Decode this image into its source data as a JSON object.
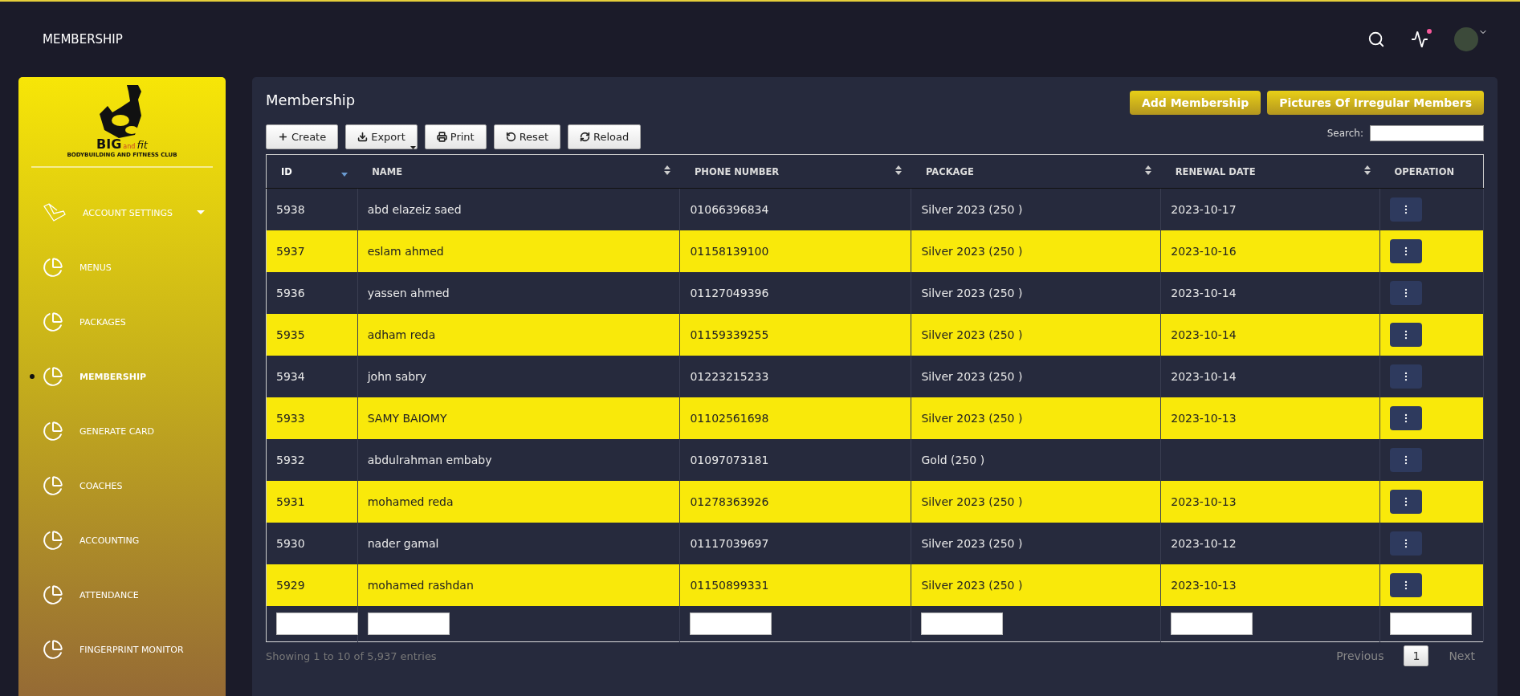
{
  "header": {
    "title": "MEMBERSHIP",
    "notification": true
  },
  "logo": {
    "word": "BIG",
    "accent": "and",
    "word2": "fit",
    "tagline": "BODYBUILDING AND FITNESS CLUB"
  },
  "sidebar": {
    "items": [
      {
        "label": "ACCOUNT SETTINGS",
        "kind": "dropdown",
        "selected": false
      },
      {
        "label": "MENUS",
        "kind": "link",
        "selected": false
      },
      {
        "label": "PACKAGES",
        "kind": "link",
        "selected": false
      },
      {
        "label": "MEMBERSHIP",
        "kind": "link",
        "selected": true
      },
      {
        "label": "GENERATE CARD",
        "kind": "link",
        "selected": false
      },
      {
        "label": "COACHES",
        "kind": "link",
        "selected": false
      },
      {
        "label": "ACCOUNTING",
        "kind": "link",
        "selected": false
      },
      {
        "label": "ATTENDANCE",
        "kind": "link",
        "selected": false
      },
      {
        "label": "FINGERPRINT MONITOR",
        "kind": "link",
        "selected": false
      }
    ]
  },
  "panel": {
    "title": "Membership",
    "actions": [
      "Add Membership",
      "Pictures Of Irregular Members"
    ],
    "toolbar": [
      {
        "label": "Create",
        "kind": "plus"
      },
      {
        "label": "Export",
        "kind": "download"
      },
      {
        "label": "Print",
        "kind": "print"
      },
      {
        "label": "Reset",
        "kind": "undo"
      },
      {
        "label": "Reload",
        "kind": "refresh"
      }
    ],
    "search": {
      "label": "Search:"
    }
  },
  "table": {
    "columns": [
      {
        "label": "ID",
        "sortable": true,
        "sorted": true
      },
      {
        "label": "NAME",
        "sortable": true,
        "sorted": false
      },
      {
        "label": "PHONE NUMBER",
        "sortable": true,
        "sorted": false
      },
      {
        "label": "PACKAGE",
        "sortable": true,
        "sorted": false
      },
      {
        "label": "RENEWAL DATE",
        "sortable": true,
        "sorted": false
      },
      {
        "label": "OPERATION",
        "sortable": false,
        "sorted": false
      }
    ],
    "rows": [
      [
        "5938",
        "abd elazeiz saed",
        "01066396834",
        "Silver 2023 (250 )",
        "2023-10-17"
      ],
      [
        "5937",
        "eslam ahmed",
        "01158139100",
        "Silver 2023 (250 )",
        "2023-10-16"
      ],
      [
        "5936",
        "yassen ahmed",
        "01127049396",
        "Silver 2023 (250 )",
        "2023-10-14"
      ],
      [
        "5935",
        "adham reda",
        "01159339255",
        "Silver 2023 (250 )",
        "2023-10-14"
      ],
      [
        "5934",
        "john sabry",
        "01223215233",
        "Silver 2023 (250 )",
        "2023-10-14"
      ],
      [
        "5933",
        "SAMY BAIOMY",
        "01102561698",
        "Silver 2023 (250 )",
        "2023-10-13"
      ],
      [
        "5932",
        "abdulrahman embaby",
        "01097073181",
        "Gold (250 )",
        ""
      ],
      [
        "5931",
        "mohamed reda",
        "01278363926",
        "Silver 2023 (250 )",
        "2023-10-13"
      ],
      [
        "5930",
        "nader gamal",
        "01117039697",
        "Silver 2023 (250 )",
        "2023-10-12"
      ],
      [
        "5929",
        "mohamed rashdan",
        "01150899331",
        "Silver 2023 (250 )",
        "2023-10-13"
      ]
    ]
  },
  "footer": {
    "info": "Showing 1 to 10 of 5,937 entries",
    "pages": [
      {
        "label": "Previous",
        "selected": false
      },
      {
        "label": "1",
        "selected": true
      },
      {
        "label": "Next",
        "selected": false
      }
    ]
  }
}
